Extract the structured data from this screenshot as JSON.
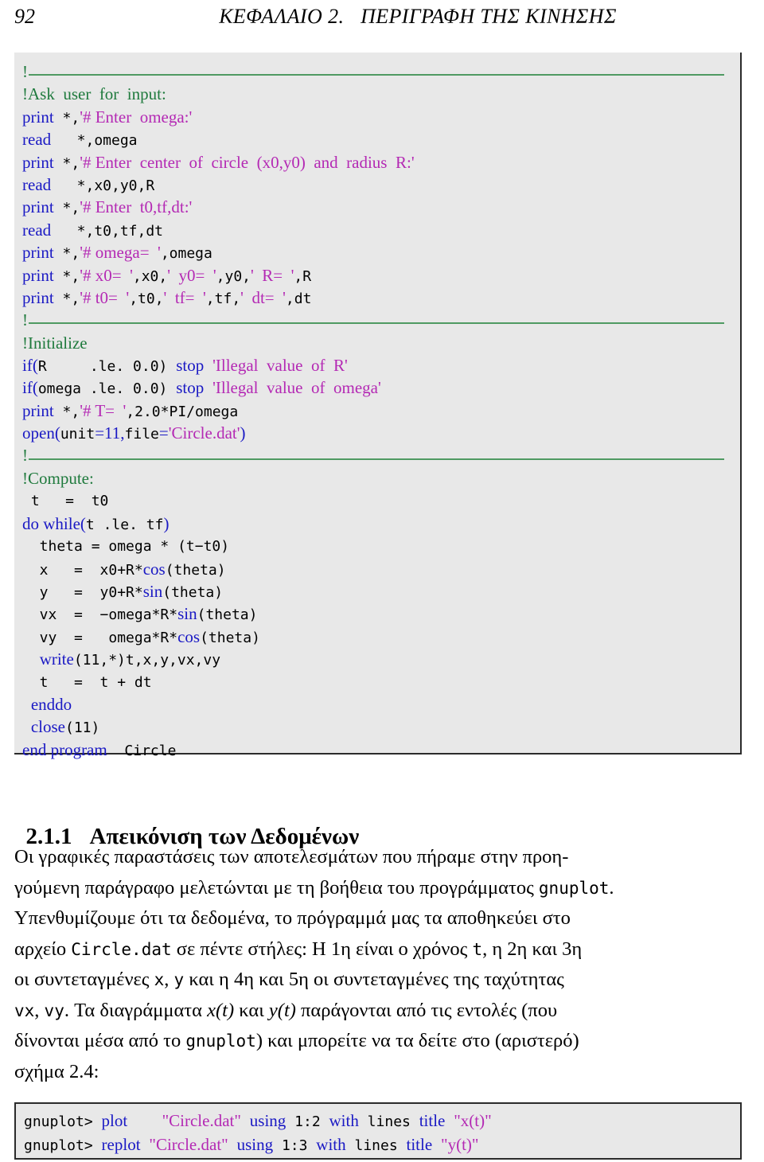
{
  "header": {
    "folio": "92",
    "chapter_title": "ΚΕΦΑΛΑΙΟ 2.   ΠΕΡΙΓΡΑΦΗ ΤΗΣ ΚΙΝΗΣΗΣ"
  },
  "colors": {
    "keyword": "#1a19c4",
    "string": "#b429b4",
    "comment": "#1f7a3d",
    "plain": "#000000",
    "code_background": "#e8e8e8",
    "code_border": "#2b2b2b",
    "rule": "#4f9a62"
  },
  "fortran_listing": {
    "language": "fortran",
    "bang": "!",
    "lines": [
      {
        "type": "rule"
      },
      {
        "type": "code",
        "tokens": [
          {
            "t": "cmt",
            "v": "!Ask  user  for  input:"
          }
        ]
      },
      {
        "type": "code",
        "tokens": [
          {
            "t": "kw",
            "v": "print"
          },
          {
            "t": "op",
            "v": " *,"
          },
          {
            "t": "str",
            "v": "'# Enter  omega:'"
          }
        ]
      },
      {
        "type": "code",
        "tokens": [
          {
            "t": "kw",
            "v": "read"
          },
          {
            "t": "op",
            "v": "   *,"
          },
          {
            "t": "var",
            "v": "omega"
          }
        ]
      },
      {
        "type": "code",
        "tokens": [
          {
            "t": "kw",
            "v": "print"
          },
          {
            "t": "op",
            "v": " *,"
          },
          {
            "t": "str",
            "v": "'# Enter  center  of  circle  (x0,y0)  and  radius  R:'"
          }
        ]
      },
      {
        "type": "code",
        "tokens": [
          {
            "t": "kw",
            "v": "read"
          },
          {
            "t": "op",
            "v": "   *,"
          },
          {
            "t": "var",
            "v": "x0,y0,R"
          }
        ]
      },
      {
        "type": "code",
        "tokens": [
          {
            "t": "kw",
            "v": "print"
          },
          {
            "t": "op",
            "v": " *,"
          },
          {
            "t": "str",
            "v": "'# Enter  t0,tf,dt:'"
          }
        ]
      },
      {
        "type": "code",
        "tokens": [
          {
            "t": "kw",
            "v": "read"
          },
          {
            "t": "op",
            "v": "   *,"
          },
          {
            "t": "var",
            "v": "t0,tf,dt"
          }
        ]
      },
      {
        "type": "code",
        "tokens": [
          {
            "t": "kw",
            "v": "print"
          },
          {
            "t": "op",
            "v": " *,"
          },
          {
            "t": "str",
            "v": "'# omega=  '"
          },
          {
            "t": "op",
            "v": ","
          },
          {
            "t": "var",
            "v": "omega"
          }
        ]
      },
      {
        "type": "code",
        "tokens": [
          {
            "t": "kw",
            "v": "print"
          },
          {
            "t": "op",
            "v": " *,"
          },
          {
            "t": "str",
            "v": "'# x0=  '"
          },
          {
            "t": "op",
            "v": ","
          },
          {
            "t": "var",
            "v": "x0,"
          },
          {
            "t": "str",
            "v": "'  y0=  '"
          },
          {
            "t": "op",
            "v": ","
          },
          {
            "t": "var",
            "v": "y0,"
          },
          {
            "t": "str",
            "v": "'  R=  '"
          },
          {
            "t": "op",
            "v": ","
          },
          {
            "t": "var",
            "v": "R"
          }
        ]
      },
      {
        "type": "code",
        "tokens": [
          {
            "t": "kw",
            "v": "print"
          },
          {
            "t": "op",
            "v": " *,"
          },
          {
            "t": "str",
            "v": "'# t0=  '"
          },
          {
            "t": "op",
            "v": ","
          },
          {
            "t": "var",
            "v": "t0,"
          },
          {
            "t": "str",
            "v": "'  tf=  '"
          },
          {
            "t": "op",
            "v": ","
          },
          {
            "t": "var",
            "v": "tf,"
          },
          {
            "t": "str",
            "v": "'  dt=  '"
          },
          {
            "t": "op",
            "v": ","
          },
          {
            "t": "var",
            "v": "dt"
          }
        ]
      },
      {
        "type": "rule"
      },
      {
        "type": "code",
        "tokens": [
          {
            "t": "cmt",
            "v": "!Initialize"
          }
        ]
      },
      {
        "type": "code",
        "tokens": [
          {
            "t": "kw",
            "v": "if("
          },
          {
            "t": "var",
            "v": "R     "
          },
          {
            "t": "op",
            "v": ".le. 0.0) "
          },
          {
            "t": "kw",
            "v": "stop"
          },
          {
            "t": "op",
            "v": " "
          },
          {
            "t": "str",
            "v": "'Illegal  value  of  R'"
          }
        ]
      },
      {
        "type": "code",
        "tokens": [
          {
            "t": "kw",
            "v": "if("
          },
          {
            "t": "var",
            "v": "omega "
          },
          {
            "t": "op",
            "v": ".le. 0.0) "
          },
          {
            "t": "kw",
            "v": "stop"
          },
          {
            "t": "op",
            "v": " "
          },
          {
            "t": "str",
            "v": "'Illegal  value  of  omega'"
          }
        ]
      },
      {
        "type": "code",
        "tokens": [
          {
            "t": "kw",
            "v": "print"
          },
          {
            "t": "op",
            "v": " *,"
          },
          {
            "t": "str",
            "v": "'# T=  '"
          },
          {
            "t": "op",
            "v": ",2.0*"
          },
          {
            "t": "var",
            "v": "PI"
          },
          {
            "t": "op",
            "v": "/"
          },
          {
            "t": "var",
            "v": "omega"
          }
        ]
      },
      {
        "type": "code",
        "tokens": [
          {
            "t": "kw",
            "v": "open("
          },
          {
            "t": "var",
            "v": "unit"
          },
          {
            "t": "kw",
            "v": "=11,"
          },
          {
            "t": "var",
            "v": "file"
          },
          {
            "t": "kw",
            "v": "="
          },
          {
            "t": "str",
            "v": "'Circle.dat'"
          },
          {
            "t": "kw",
            "v": ")"
          }
        ]
      },
      {
        "type": "rule"
      },
      {
        "type": "code",
        "tokens": [
          {
            "t": "cmt",
            "v": "!Compute:"
          }
        ]
      },
      {
        "type": "code",
        "tokens": [
          {
            "t": "var",
            "v": " t   =  t0"
          }
        ]
      },
      {
        "type": "code",
        "tokens": [
          {
            "t": "kw",
            "v": "do while("
          },
          {
            "t": "var",
            "v": "t"
          },
          {
            "t": "op",
            "v": " .le. "
          },
          {
            "t": "var",
            "v": "tf"
          },
          {
            "t": "kw",
            "v": ")"
          }
        ]
      },
      {
        "type": "code",
        "tokens": [
          {
            "t": "var",
            "v": "  theta = omega * (t"
          },
          {
            "t": "op",
            "v": "−"
          },
          {
            "t": "var",
            "v": "t0)"
          }
        ]
      },
      {
        "type": "code",
        "tokens": [
          {
            "t": "var",
            "v": "  x   =  x0+R*"
          },
          {
            "t": "kw",
            "v": "cos"
          },
          {
            "t": "var",
            "v": "(theta)"
          }
        ]
      },
      {
        "type": "code",
        "tokens": [
          {
            "t": "var",
            "v": "  y   =  y0+R*"
          },
          {
            "t": "kw",
            "v": "sin"
          },
          {
            "t": "var",
            "v": "(theta)"
          }
        ]
      },
      {
        "type": "code",
        "tokens": [
          {
            "t": "var",
            "v": "  vx  =  "
          },
          {
            "t": "op",
            "v": "−"
          },
          {
            "t": "var",
            "v": "omega*R*"
          },
          {
            "t": "kw",
            "v": "sin"
          },
          {
            "t": "var",
            "v": "(theta)"
          }
        ]
      },
      {
        "type": "code",
        "tokens": [
          {
            "t": "var",
            "v": "  vy  =   omega*R*"
          },
          {
            "t": "kw",
            "v": "cos"
          },
          {
            "t": "var",
            "v": "(theta)"
          }
        ]
      },
      {
        "type": "code",
        "tokens": [
          {
            "t": "op",
            "v": "  "
          },
          {
            "t": "kw",
            "v": "write"
          },
          {
            "t": "var",
            "v": "(11,*)t,x,y,vx,vy"
          }
        ]
      },
      {
        "type": "code",
        "tokens": [
          {
            "t": "var",
            "v": "  t   =  t + dt"
          }
        ]
      },
      {
        "type": "code",
        "tokens": [
          {
            "t": "op",
            "v": " "
          },
          {
            "t": "kw",
            "v": "enddo"
          }
        ]
      },
      {
        "type": "code",
        "tokens": [
          {
            "t": "op",
            "v": " "
          },
          {
            "t": "kw",
            "v": "close"
          },
          {
            "t": "var",
            "v": "(11)"
          }
        ]
      },
      {
        "type": "code",
        "tokens": [
          {
            "t": "kw",
            "v": "end program"
          },
          {
            "t": "var",
            "v": "  Circle"
          }
        ]
      }
    ]
  },
  "section": {
    "number": "2.1.1",
    "title": "Απεικόνιση των Δεδομένων"
  },
  "paragraph": {
    "lines": [
      [
        {
          "t": "n",
          "v": "Οι γραφικές παραστάσεις των αποτελεσμάτων που πήραμε στην προη-"
        }
      ],
      [
        {
          "t": "n",
          "v": "γούμενη παράγραφο μελετώνται με τη βοήθεια του προγράμματος "
        },
        {
          "t": "tt",
          "v": "gnuplot"
        },
        {
          "t": "n",
          "v": "."
        }
      ],
      [
        {
          "t": "n",
          "v": "Υπενθυμίζουμε ότι τα δεδομένα, το πρόγραμμά μας τα αποθηκεύει στο"
        }
      ],
      [
        {
          "t": "n",
          "v": "αρχείο "
        },
        {
          "t": "tt",
          "v": "Circle.dat"
        },
        {
          "t": "n",
          "v": " σε πέντε στήλες: Η 1η είναι ο χρόνος "
        },
        {
          "t": "tt",
          "v": "t"
        },
        {
          "t": "n",
          "v": ", η 2η και 3η"
        }
      ],
      [
        {
          "t": "n",
          "v": "οι συντεταγμένες "
        },
        {
          "t": "tt",
          "v": "x"
        },
        {
          "t": "n",
          "v": ", "
        },
        {
          "t": "tt",
          "v": "y"
        },
        {
          "t": "n",
          "v": " και η 4η και 5η οι συντεταγμένες της ταχύτητας"
        }
      ],
      [
        {
          "t": "tt",
          "v": "vx"
        },
        {
          "t": "n",
          "v": ", "
        },
        {
          "t": "tt",
          "v": "vy"
        },
        {
          "t": "n",
          "v": ". Τα διαγράμματα "
        },
        {
          "t": "math",
          "v": "x(t)"
        },
        {
          "t": "n",
          "v": " και "
        },
        {
          "t": "math",
          "v": "y(t)"
        },
        {
          "t": "n",
          "v": " παράγονται από τις εντολές (που"
        }
      ],
      [
        {
          "t": "n",
          "v": "δίνονται μέσα από το "
        },
        {
          "t": "tt",
          "v": "gnuplot"
        },
        {
          "t": "n",
          "v": ") και μπορείτε να τα δείτε στο (αριστερό)"
        }
      ],
      [
        {
          "t": "n",
          "v": "σχήμα 2.4:"
        }
      ]
    ]
  },
  "gnuplot_listing": {
    "language": "gnuplot",
    "lines": [
      {
        "type": "code",
        "tokens": [
          {
            "t": "var",
            "v": "gnuplot> "
          },
          {
            "t": "kw",
            "v": "plot"
          },
          {
            "t": "var",
            "v": "    "
          },
          {
            "t": "str",
            "v": "\"Circle.dat\""
          },
          {
            "t": "var",
            "v": " "
          },
          {
            "t": "kw",
            "v": "using"
          },
          {
            "t": "var",
            "v": " 1:2 "
          },
          {
            "t": "kw",
            "v": "with"
          },
          {
            "t": "var",
            "v": " lines "
          },
          {
            "t": "kw",
            "v": "title"
          },
          {
            "t": "var",
            "v": " "
          },
          {
            "t": "str",
            "v": "\"x(t)\""
          }
        ]
      },
      {
        "type": "code",
        "tokens": [
          {
            "t": "var",
            "v": "gnuplot> "
          },
          {
            "t": "kw",
            "v": "replot"
          },
          {
            "t": "var",
            "v": " "
          },
          {
            "t": "str",
            "v": "\"Circle.dat\""
          },
          {
            "t": "var",
            "v": " "
          },
          {
            "t": "kw",
            "v": "using"
          },
          {
            "t": "var",
            "v": " 1:3 "
          },
          {
            "t": "kw",
            "v": "with"
          },
          {
            "t": "var",
            "v": " lines "
          },
          {
            "t": "kw",
            "v": "title"
          },
          {
            "t": "var",
            "v": " "
          },
          {
            "t": "str",
            "v": "\"y(t)\""
          }
        ]
      }
    ]
  }
}
